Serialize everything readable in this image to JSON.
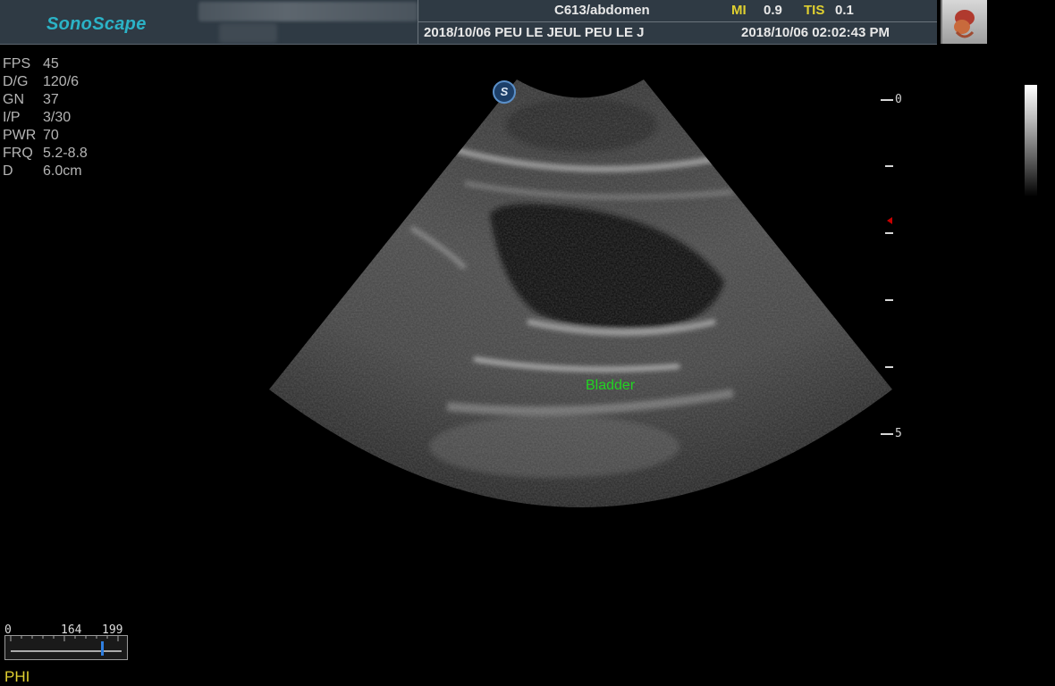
{
  "header": {
    "logo": "SonoScape",
    "probe_preset": "C613/abdomen",
    "mi_label": "MI",
    "mi_value": "0.9",
    "tis_label": "TIS",
    "tis_value": "0.1",
    "date_patient": "2018/10/06  PEU LE JEUL PEU LE J",
    "datetime": "2018/10/06 02:02:43 PM"
  },
  "params": [
    {
      "key": "FPS",
      "value": "45"
    },
    {
      "key": "D/G",
      "value": "120/6"
    },
    {
      "key": "GN",
      "value": "37"
    },
    {
      "key": "I/P",
      "value": "3/30"
    },
    {
      "key": "PWR",
      "value": "70"
    },
    {
      "key": "FRQ",
      "value": "5.2-8.8"
    },
    {
      "key": "D",
      "value": "6.0cm"
    }
  ],
  "annotation": {
    "bladder": "Bladder"
  },
  "depth_scale": {
    "top": "0",
    "bottom": "5"
  },
  "gauge": {
    "min": "0",
    "current": "164",
    "max": "199",
    "level_fraction": 0.82
  },
  "mode_label": "PHI",
  "icons": {
    "logo_s": "S",
    "organ": "abdomen-organ-icon"
  }
}
